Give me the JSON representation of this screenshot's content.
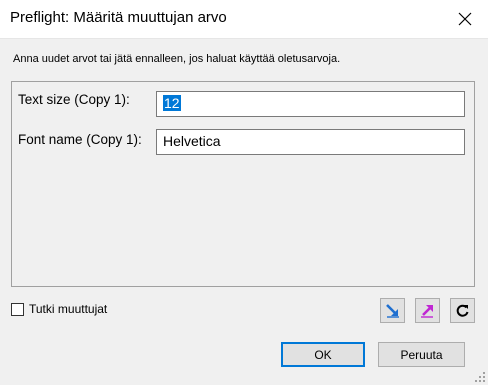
{
  "window": {
    "title": "Preflight: Määritä muuttujan arvo",
    "close_icon": "close-icon"
  },
  "instruction": "Anna uudet arvot tai jätä ennalleen, jos haluat käyttää oletusarvoja.",
  "fields": [
    {
      "label": "Text size (Copy 1):",
      "value": "12"
    },
    {
      "label": "Font name (Copy 1):",
      "value": "Helvetica"
    }
  ],
  "checkbox": {
    "label": "Tutki muuttujat",
    "checked": false
  },
  "icons": {
    "import": "import-arrow-icon",
    "export": "export-arrow-icon",
    "reset": "reset-icon"
  },
  "buttons": {
    "ok": "OK",
    "cancel": "Peruuta"
  },
  "colors": {
    "accent": "#0078d7",
    "import_arrow": "#1f6fd0",
    "export_arrow": "#c026d3"
  }
}
